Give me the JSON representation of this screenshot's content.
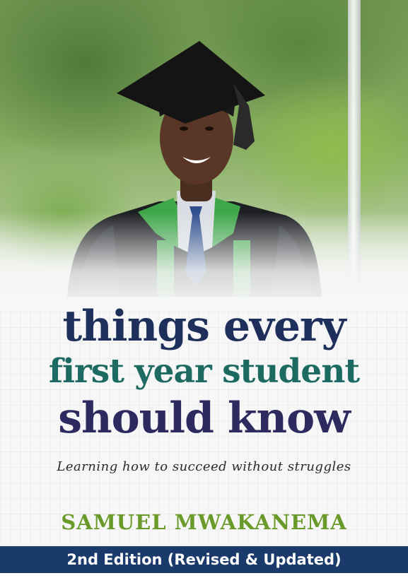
{
  "cover": {
    "title_line1": "things every",
    "title_line2": "first year student",
    "title_line3": "should know",
    "subtitle": "Learning how to succeed without struggles",
    "author": "SAMUEL MWAKANEMA",
    "edition": "2nd Edition (Revised & Updated)"
  },
  "colors": {
    "title_navy": "#1f2f5c",
    "title_teal": "#1d6a62",
    "title_indigo": "#2c2a5e",
    "author_green": "#6a9a2a",
    "band_navy": "#1a3a6b"
  }
}
